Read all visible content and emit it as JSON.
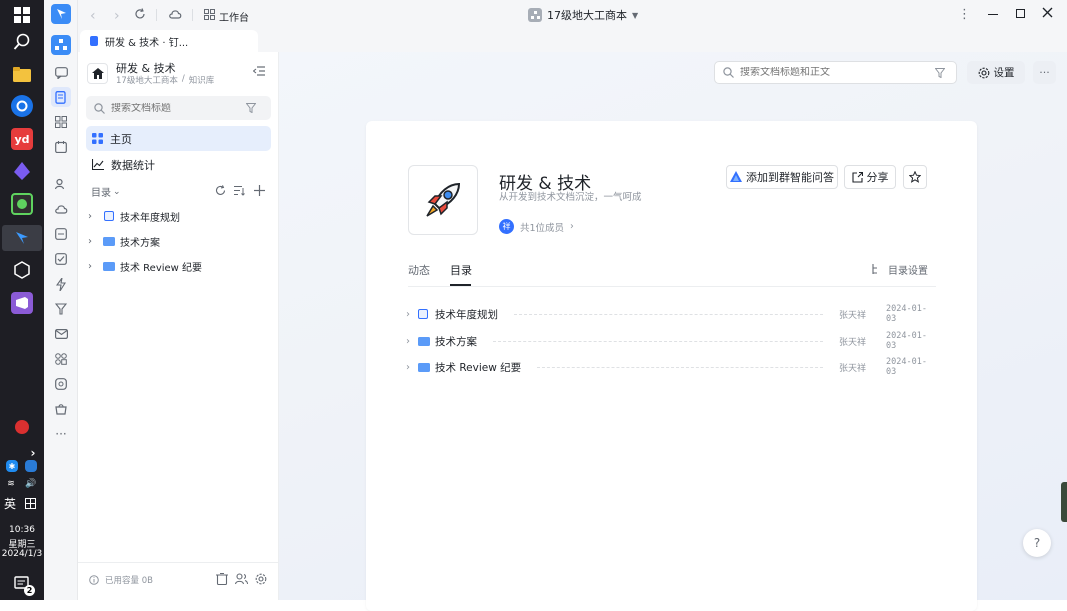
{
  "taskbar": {
    "time": "10:36",
    "weekday": "星期三",
    "date": "2024/1/3",
    "ime": "英",
    "notif_count": "2",
    "more": "···"
  },
  "titlebar": {
    "workspace_label": "工作台",
    "org_name": "17级地大工商本",
    "more": "⋮"
  },
  "tab": {
    "title": "研发 & 技术 · 钉..."
  },
  "sidebar": {
    "space_title": "研发 & 技术",
    "breadcrumb_org": "17级地大工商本",
    "breadcrumb_sep": "/",
    "breadcrumb_kb": "知识库",
    "search_placeholder": "搜索文档标题",
    "nav": [
      {
        "label": "主页"
      },
      {
        "label": "数据统计"
      }
    ],
    "catalog_label": "目录",
    "tree": [
      {
        "label": "技术年度规划"
      },
      {
        "label": "技术方案"
      },
      {
        "label": "技术 Review 纪要"
      }
    ],
    "footer_usage": "已用容量 0B"
  },
  "main": {
    "search_placeholder": "搜索文档标题和正文",
    "settings_label": "设置",
    "more_label": "···",
    "space_name": "研发 & 技术",
    "space_desc": "从开发到技术文档沉淀，一气呵成",
    "member_avatar": "祥",
    "member_count": "共1位成员",
    "add_group_label": "添加到群智能问答",
    "share_label": "分享",
    "tabs": [
      {
        "label": "动态"
      },
      {
        "label": "目录"
      }
    ],
    "catalog_settings": "目录设置",
    "docs": [
      {
        "name": "技术年度规划",
        "owner": "张天祥",
        "date": "2024-01-03"
      },
      {
        "name": "技术方案",
        "owner": "张天祥",
        "date": "2024-01-03"
      },
      {
        "name": "技术 Review 纪要",
        "owner": "张天祥",
        "date": "2024-01-03"
      }
    ],
    "help_label": "?"
  },
  "colors": {
    "accent": "#3370ff",
    "active_bg": "#e6eefc",
    "folder": "#5b9bf8"
  }
}
